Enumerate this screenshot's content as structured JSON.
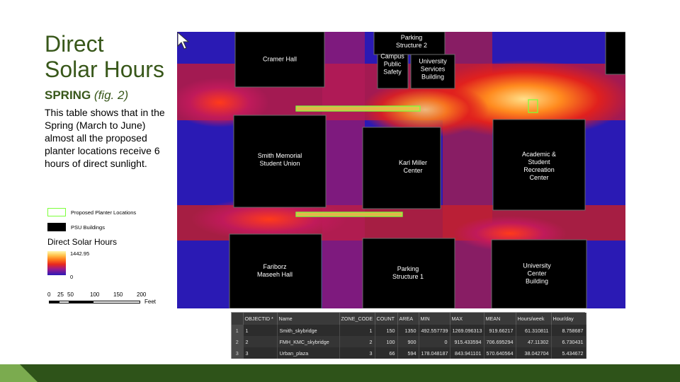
{
  "title": {
    "line1": "Direct",
    "line2": "Solar Hours"
  },
  "subtitle": {
    "season": "SPRING",
    "figure": "(fig. 2)"
  },
  "body_text": "This table shows that in the Spring (March to June) almost all the proposed planter locations receive 6 hours of direct sunlight.",
  "legend": {
    "planter_label": "Proposed Planter Locations",
    "planter_color": "#7cff3a",
    "buildings_label": "PSU Buildings",
    "heading": "Direct Solar Hours",
    "max_value": "1442.95",
    "min_value": "0",
    "scale_labels": [
      "0",
      "25",
      "50",
      "100",
      "150",
      "200"
    ],
    "scale_unit": "Feet"
  },
  "map": {
    "buildings": [
      {
        "key": "cramer",
        "label": "Cramer Hall"
      },
      {
        "key": "parking2",
        "label": "Parking\nStructure 2"
      },
      {
        "key": "safety",
        "label": "Campus\nPublic\nSafety"
      },
      {
        "key": "services",
        "label": "University\nServices\nBuilding"
      },
      {
        "key": "smu",
        "label": "Smith Memorial\nStudent Union"
      },
      {
        "key": "kmc",
        "label": "Karl Miller\nCenter"
      },
      {
        "key": "asrc",
        "label": "Academic &\nStudent\nRecreation\nCenter"
      },
      {
        "key": "fmh",
        "label": "Fariborz\nMaseeh Hall"
      },
      {
        "key": "parking1",
        "label": "Parking\nStructure 1"
      },
      {
        "key": "ucb",
        "label": "University\nCenter\nBuilding"
      }
    ]
  },
  "table": {
    "columns": [
      "",
      "OBJECTID *",
      "Name",
      "ZONE_CODE",
      "COUNT",
      "AREA",
      "MIN",
      "MAX",
      "MEAN",
      "Hours/week",
      "Hour/day"
    ],
    "rows": [
      [
        "1",
        "1",
        "Smith_skybridge",
        "1",
        "150",
        "1350",
        "492.557739",
        "1269.096313",
        "919.66217",
        "61.310811",
        "8.758687"
      ],
      [
        "2",
        "2",
        "FMH_KMC_skybridge",
        "2",
        "100",
        "900",
        "0",
        "915.433594",
        "706.695294",
        "47.11302",
        "6.730431"
      ],
      [
        "3",
        "3",
        "Urban_plaza",
        "3",
        "66",
        "594",
        "178.048187",
        "843.941101",
        "570.640564",
        "38.042704",
        "5.434672"
      ]
    ]
  },
  "colors": {
    "title_green": "#38571a",
    "footer_green": "#2e5319",
    "footer_accent": "#7bab4f"
  }
}
